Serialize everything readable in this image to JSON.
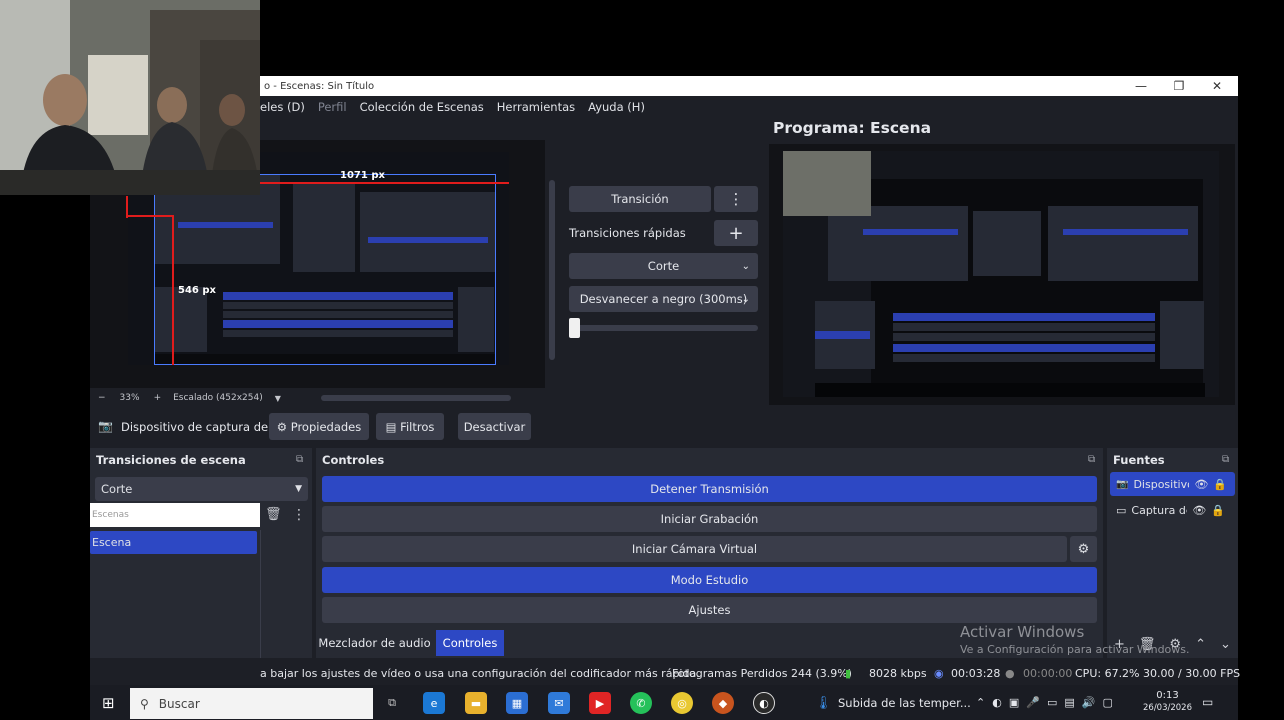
{
  "window": {
    "title": "o - Escenas: Sin Título",
    "minimize": "—",
    "maximize": "❐",
    "close": "✕"
  },
  "menu": {
    "items": [
      "eles (D)",
      "Perfil",
      "Colección de Escenas",
      "Herramientas",
      "Ayuda (H)"
    ]
  },
  "program": {
    "title": "Programa: Escena"
  },
  "preview": {
    "measure_top": "1071 px",
    "measure_left": "546 px",
    "zoom_minus": "−",
    "zoom": "33%",
    "zoom_plus": "+",
    "scale_label": "Escalado (452x254)"
  },
  "transitions_mid": {
    "transition_button": "Transición",
    "menu_dots": "⋮",
    "quick_label": "Transiciones rápidas",
    "add": "+",
    "cut": "Corte",
    "fade_black": "Desvanecer a negro (300ms)",
    "slider_fraction": 0.0
  },
  "source_toolbar": {
    "source_name": "Dispositivo de captura de v",
    "properties": "Propiedades",
    "filters": "Filtros",
    "deactivate": "Desactivar"
  },
  "scene_transitions_dock": {
    "title": "Transiciones de escena",
    "selected": "Corte",
    "scenes_filter_placeholder": "Escenas",
    "scenes": [
      "Escena"
    ]
  },
  "controls_dock": {
    "title": "Controles",
    "buttons": [
      {
        "label": "Detener Transmisión",
        "active": true
      },
      {
        "label": "Iniciar Grabación",
        "active": false
      },
      {
        "label": "Iniciar Cámara Virtual",
        "active": false
      },
      {
        "label": "Modo Estudio",
        "active": true
      },
      {
        "label": "Ajustes",
        "active": false
      }
    ],
    "tabs": [
      "Mezclador de audio",
      "Controles"
    ]
  },
  "sources_dock": {
    "title": "Fuentes",
    "items": [
      "Dispositivo",
      "Captura de"
    ]
  },
  "status": {
    "message": "a bajar los ajustes de vídeo o usa una configuración del codificador más rápida.",
    "dropped": "Fotogramas Perdidos 244 (3.9%)",
    "bitrate": "8028 kbps",
    "stream_time": "00:03:28",
    "rec_time": "00:00:00",
    "cpu": "CPU: 67.2%",
    "fps": "30.00 / 30.00 FPS"
  },
  "watermark": {
    "line1": "Activar Windows",
    "line2": "Ve a Configuración para activar Windows."
  },
  "taskbar": {
    "search_placeholder": "Buscar",
    "notification": "Subida de las temper...",
    "time": "0:13",
    "date": "26/03/2026"
  },
  "colors": {
    "accent": "#2d48c4",
    "panel": "#272a33",
    "background": "#1d1f26"
  }
}
